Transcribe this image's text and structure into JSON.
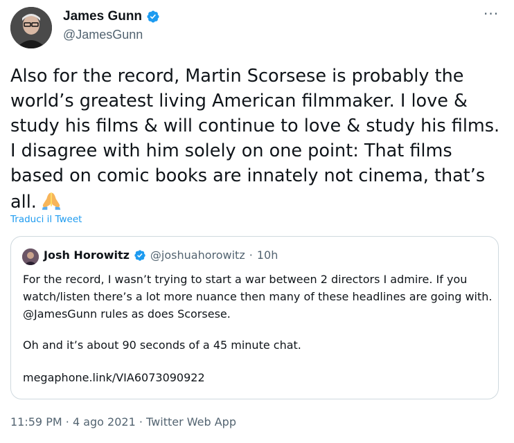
{
  "author": {
    "name": "James Gunn",
    "handle": "@JamesGunn",
    "verified": true
  },
  "more_button": "···",
  "tweet_text": "Also for the record, Martin Scorsese is probably the world’s greatest living American filmmaker. I love & study his films & will continue to love & study his films. I disagree with him solely on one point: That films based on comic books are innately not cinema, that’s all.",
  "emoji": "folded-hands",
  "translate_link": "Traduci il Tweet",
  "quoted_tweet": {
    "name": "Josh Horowitz",
    "handle": "@joshuahorowitz",
    "separator": "·",
    "time": "10h",
    "verified": true,
    "paragraph_1": "For the record, I wasn’t trying to start a war between 2 directors I admire. If you watch/listen there’s a lot more nuance then many of these headlines are going with. @JamesGunn rules as does Scorsese.",
    "paragraph_2": "Oh and it’s about 90 seconds of a 45 minute chat.",
    "link": "megaphone.link/VIA6073090922"
  },
  "footer": {
    "time": "11:59 PM",
    "sep1": "·",
    "date": "4 ago 2021",
    "sep2": "·",
    "source": "Twitter Web App"
  },
  "colors": {
    "text": "#0f1419",
    "secondary": "#536471",
    "link": "#1d9bf0",
    "verified": "#1d9bf0",
    "border": "#cfd9de"
  }
}
